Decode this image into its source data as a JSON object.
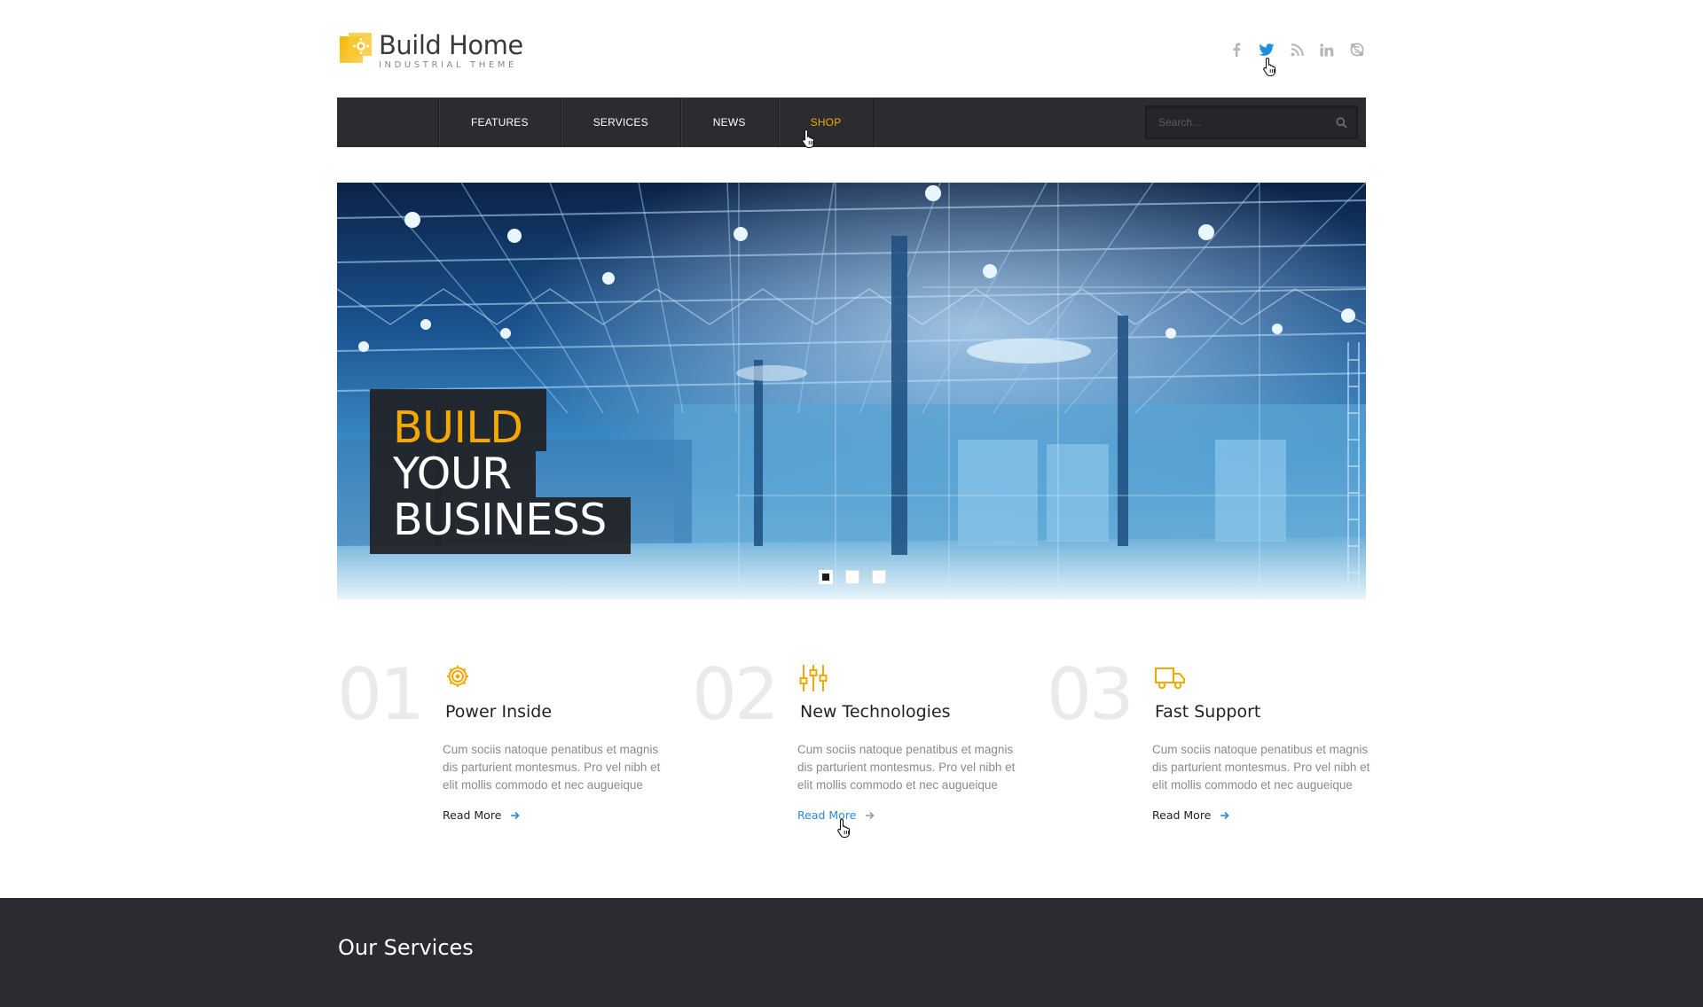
{
  "brand": {
    "title": "Build Home",
    "subtitle": "INDUSTRIAL THEME",
    "accent": "#f5a800"
  },
  "social": [
    {
      "name": "facebook-icon"
    },
    {
      "name": "twitter-icon",
      "active": true
    },
    {
      "name": "rss-icon"
    },
    {
      "name": "linkedin-icon"
    },
    {
      "name": "skype-icon"
    }
  ],
  "nav": {
    "items": [
      {
        "label": "FEATURES"
      },
      {
        "label": "SERVICES"
      },
      {
        "label": "NEWS"
      },
      {
        "label": "SHOP",
        "active": true
      }
    ],
    "search_placeholder": "Search..."
  },
  "hero": {
    "line1": "BUILD",
    "line2": "YOUR",
    "line3": "BUSINESS",
    "slide_count": 3,
    "active_slide": 1
  },
  "features": [
    {
      "number": "01",
      "icon": "gear-icon",
      "title": "Power Inside",
      "text": "Cum sociis natoque penatibus et magnis dis parturient montesmus. Pro vel nibh et elit mollis commodo et nec augueique",
      "link": "Read More"
    },
    {
      "number": "02",
      "icon": "sliders-icon",
      "title": "New Technologies",
      "text": "Cum sociis natoque penatibus et magnis dis parturient montesmus. Pro vel nibh et elit mollis commodo et nec augueique",
      "link": "Read More"
    },
    {
      "number": "03",
      "icon": "truck-icon",
      "title": "Fast Support",
      "text": "Cum sociis natoque penatibus et magnis dis parturient montesmus. Pro vel nibh et elit mollis commodo et nec augueique",
      "link": "Read More"
    }
  ],
  "services": {
    "title": "Our Services"
  },
  "colors": {
    "nav_bg": "#2b2c30",
    "link_hover": "#2a8ad8",
    "muted_number": "#eaeaea"
  }
}
